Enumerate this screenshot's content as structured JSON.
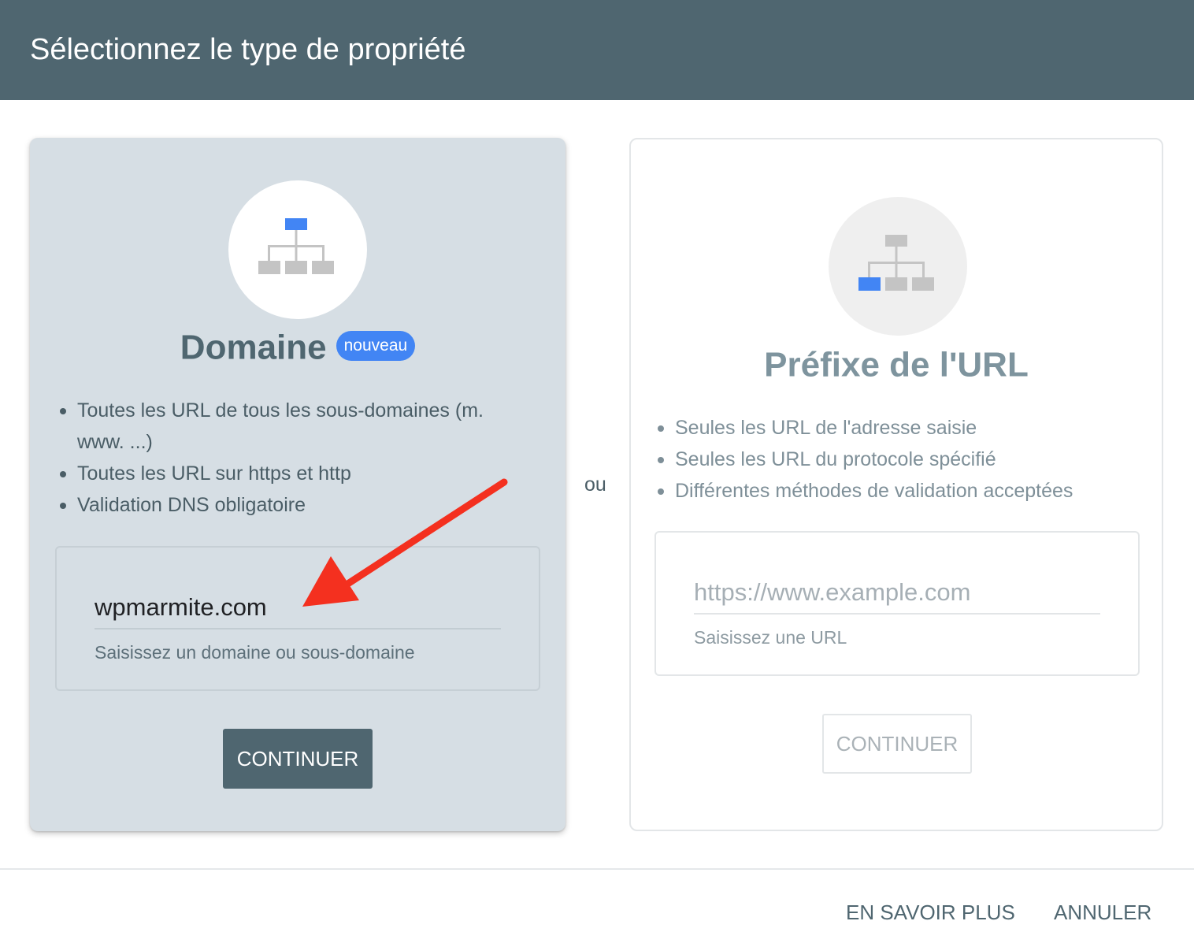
{
  "header": {
    "title": "Sélectionnez le type de propriété"
  },
  "domain_card": {
    "title": "Domaine",
    "badge": "nouveau",
    "features": [
      "Toutes les URL de tous les sous-domaines (m. www. ...)",
      "Toutes les URL sur https et http",
      "Validation DNS obligatoire"
    ],
    "input_value": "wpmarmite.com",
    "input_help": "Saisissez un domaine ou sous-domaine",
    "continue_label": "CONTINUER",
    "icon": "sitemap-icon"
  },
  "separator": "ou",
  "url_card": {
    "title": "Préfixe de l'URL",
    "features": [
      "Seules les URL de l'adresse saisie",
      "Seules les URL du protocole spécifié",
      "Différentes méthodes de validation acceptées"
    ],
    "input_placeholder": "https://www.example.com",
    "input_help": "Saisissez une URL",
    "continue_label": "CONTINUER",
    "icon": "sitemap-icon"
  },
  "footer": {
    "learn_more_label": "EN SAVOIR PLUS",
    "cancel_label": "ANNULER"
  },
  "colors": {
    "header_bg": "#4f6670",
    "accent_blue": "#4285f4",
    "annotation_arrow": "#f4301f"
  }
}
